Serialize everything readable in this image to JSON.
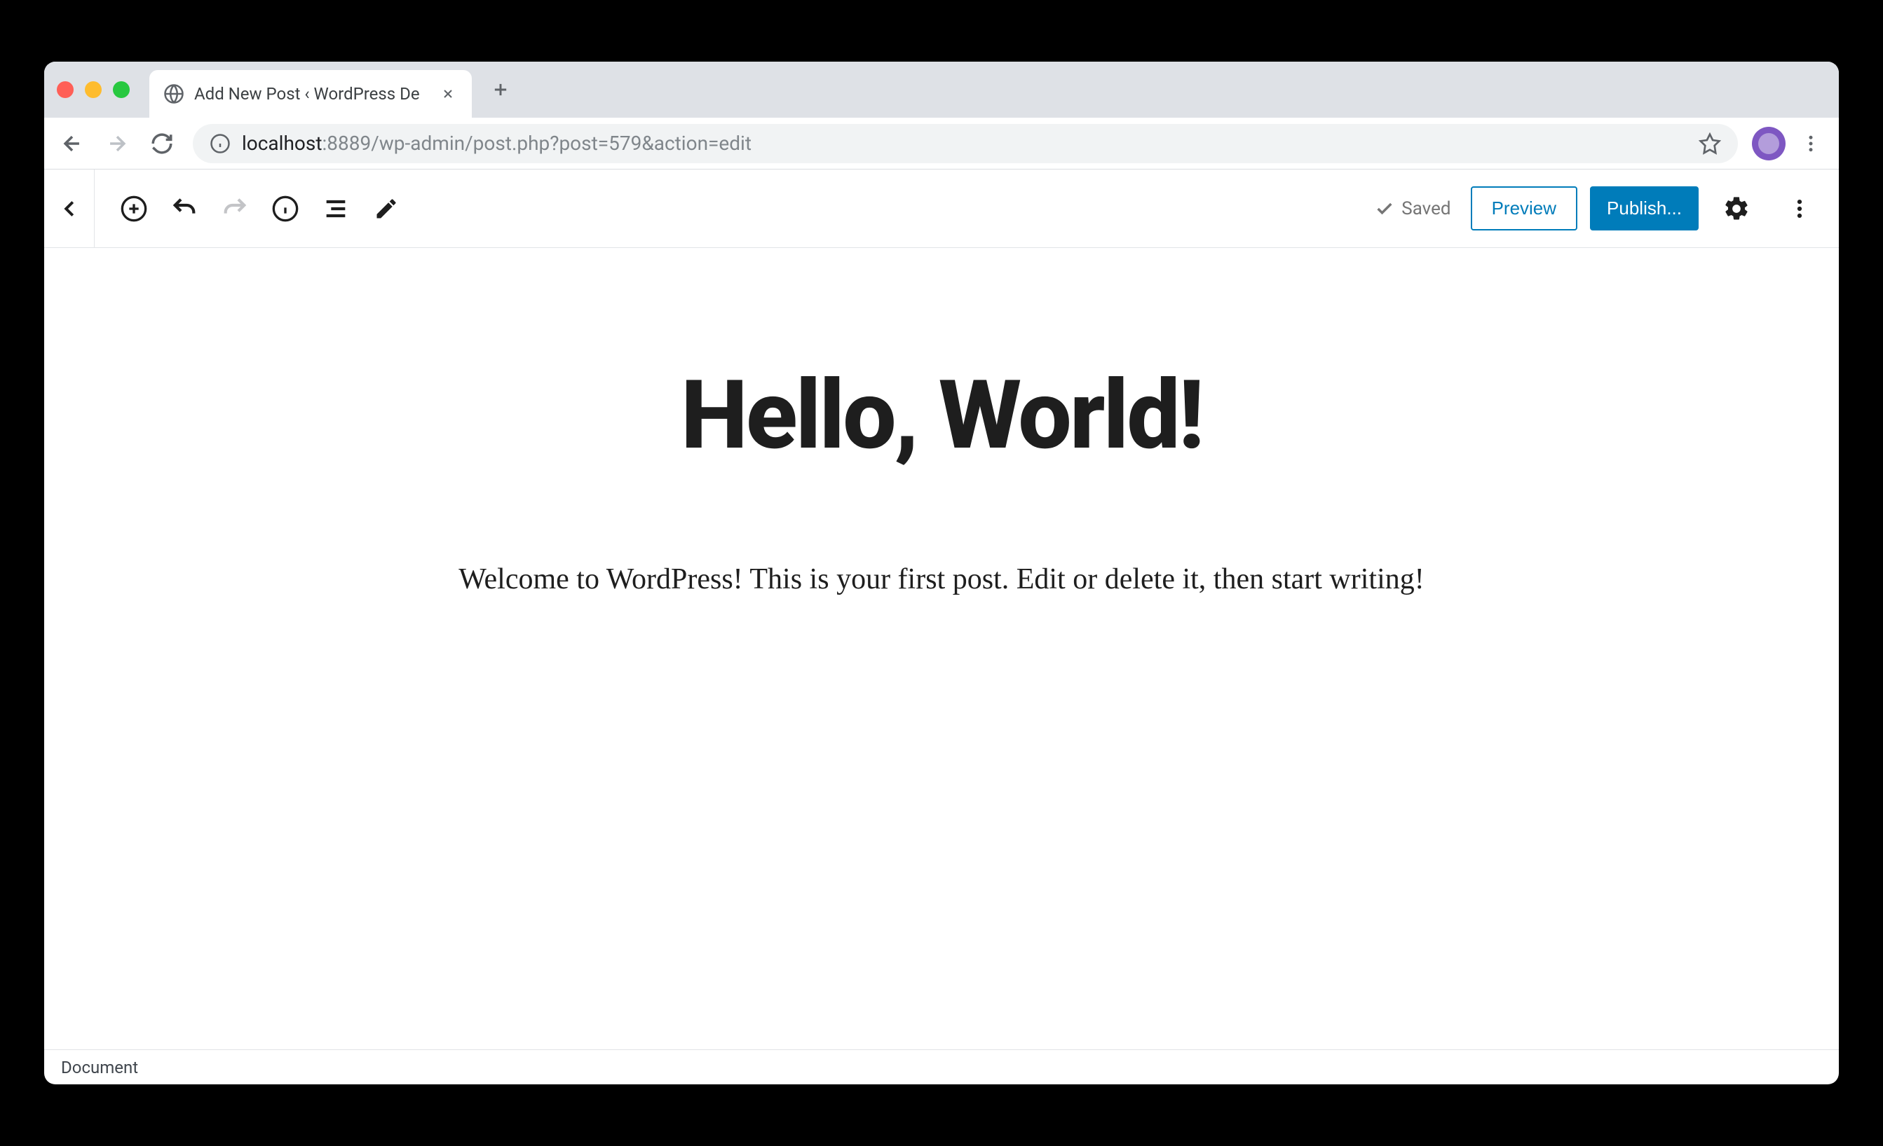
{
  "browser": {
    "tab_title": "Add New Post ‹ WordPress De",
    "url_host": "localhost",
    "url_path": ":8889/wp-admin/post.php?post=579&action=edit"
  },
  "editor": {
    "toolbar": {
      "saved_label": "Saved",
      "preview_label": "Preview",
      "publish_label": "Publish..."
    },
    "post_title": "Hello, World!",
    "post_content": "Welcome to WordPress! This is your first post. Edit or delete it, then start writing!",
    "footer_breadcrumb": "Document"
  }
}
